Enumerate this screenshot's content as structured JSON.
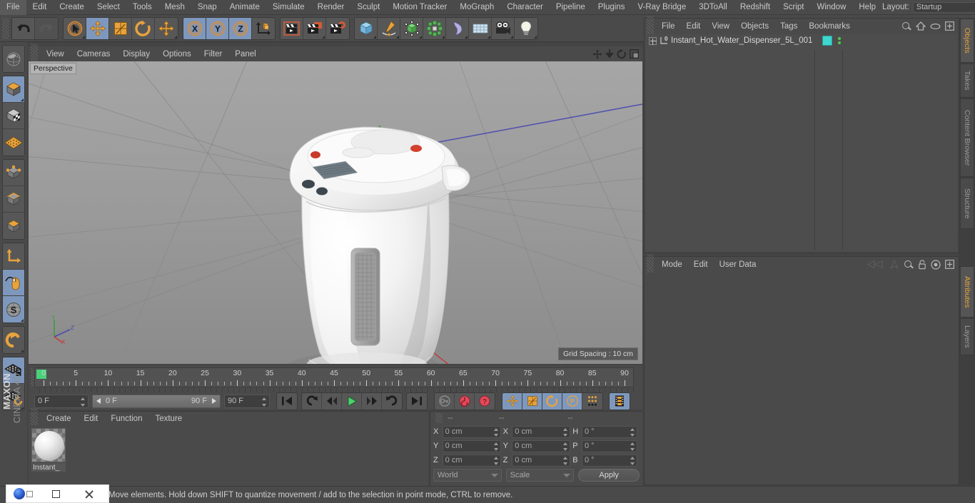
{
  "menubar": {
    "items": [
      "File",
      "Edit",
      "Create",
      "Select",
      "Tools",
      "Mesh",
      "Snap",
      "Animate",
      "Simulate",
      "Render",
      "Sculpt",
      "Motion Tracker",
      "MoGraph",
      "Character",
      "Pipeline",
      "Plugins",
      "V-Ray Bridge",
      "3DToAll",
      "Redshift",
      "Script",
      "Window",
      "Help"
    ],
    "layout_label": "Layout:",
    "layout_value": "Startup",
    "search_icon": "magnifier-icon"
  },
  "toolbar": {
    "groups": [
      {
        "buttons": [
          {
            "name": "undo",
            "icon": "undo-arrow-icon",
            "active": false,
            "disabled": false
          },
          {
            "name": "redo",
            "icon": "redo-arrow-icon",
            "active": false,
            "disabled": true
          }
        ]
      },
      {
        "buttons": [
          {
            "name": "live-selection",
            "icon": "cursor-circle-icon",
            "active": false,
            "disabled": false,
            "corner": true
          },
          {
            "name": "move",
            "icon": "move-arrows-icon",
            "active": true,
            "disabled": false
          },
          {
            "name": "scale",
            "icon": "scale-box-icon",
            "active": false,
            "disabled": false
          },
          {
            "name": "rotate",
            "icon": "rotate-circle-icon",
            "active": false,
            "disabled": false
          },
          {
            "name": "move-extra",
            "icon": "move-arrows-icon",
            "active": false,
            "disabled": false,
            "corner": true
          }
        ]
      },
      {
        "buttons": [
          {
            "name": "lock-x",
            "icon": "axis-x-icon",
            "active": true,
            "label": "X"
          },
          {
            "name": "lock-y",
            "icon": "axis-y-icon",
            "active": true,
            "label": "Y"
          },
          {
            "name": "lock-z",
            "icon": "axis-z-icon",
            "active": true,
            "label": "Z"
          },
          {
            "name": "world-object-coord",
            "icon": "coordinate-cube-icon",
            "active": false
          }
        ]
      },
      {
        "buttons": [
          {
            "name": "render-view",
            "icon": "clapper-icon",
            "active": false
          },
          {
            "name": "render-region",
            "icon": "clapper-region-icon",
            "active": false,
            "corner": true
          },
          {
            "name": "render-settings",
            "icon": "clapper-gear-icon",
            "active": false
          }
        ]
      },
      {
        "buttons": [
          {
            "name": "add-cube",
            "icon": "cube-icon",
            "active": false,
            "corner": true
          },
          {
            "name": "add-spline",
            "icon": "pen-spline-icon",
            "active": false,
            "corner": true
          },
          {
            "name": "add-nurbs",
            "icon": "green-cube-nurbs-icon",
            "active": false,
            "corner": true
          },
          {
            "name": "add-array",
            "icon": "green-cluster-icon",
            "active": false,
            "corner": true
          },
          {
            "name": "add-bend",
            "icon": "bend-deformer-icon",
            "active": false,
            "corner": true
          },
          {
            "name": "add-floor",
            "icon": "floor-grid-icon",
            "active": false,
            "corner": true
          },
          {
            "name": "add-camera",
            "icon": "camera-icon",
            "active": false,
            "corner": true
          },
          {
            "name": "add-light",
            "icon": "light-bulb-icon",
            "active": false,
            "corner": true
          }
        ]
      }
    ]
  },
  "left_palette": {
    "groups": [
      [
        {
          "name": "make-editable",
          "icon": "globe-wire-icon",
          "active": false
        }
      ],
      [
        {
          "name": "model-mode",
          "icon": "orange-cube-icon",
          "active": true,
          "corner": true
        },
        {
          "name": "texture-mode",
          "icon": "checker-cube-icon",
          "active": false
        },
        {
          "name": "workplane-mode",
          "icon": "orange-grid-plane-icon",
          "active": false
        }
      ],
      [
        {
          "name": "points-mode",
          "icon": "points-cube-icon",
          "active": false
        },
        {
          "name": "edges-mode",
          "icon": "edges-cube-icon",
          "active": false
        },
        {
          "name": "polygons-mode",
          "icon": "polygon-cube-icon",
          "active": false
        }
      ],
      [
        {
          "name": "object-axis-mode",
          "icon": "axis-l-icon",
          "active": false
        },
        {
          "name": "enable-snap",
          "icon": "mouse-snap-icon",
          "active": true
        },
        {
          "name": "lock-selection",
          "icon": "s-circle-icon",
          "active": true,
          "corner": true
        }
      ],
      [
        {
          "name": "undo-view",
          "icon": "magnet-icon",
          "active": false,
          "corner": true
        }
      ],
      [
        {
          "name": "lock-workplane",
          "icon": "grid-lock-icon",
          "active": true
        },
        {
          "name": "reset-workplane",
          "icon": "grid-rotate-icon",
          "active": false,
          "corner": true
        }
      ]
    ],
    "brand_top": "MAXON",
    "brand_bottom": "CINEMA 4D"
  },
  "viewport": {
    "menu": [
      "View",
      "Cameras",
      "Display",
      "Options",
      "Filter",
      "Panel"
    ],
    "corner_icons": [
      "pan-icon",
      "dolly-icon",
      "rotate-icon",
      "maximize-icon"
    ],
    "label": "Perspective",
    "grid_spacing": "Grid Spacing : 10 cm",
    "axis_labels": [
      "Y",
      "Z",
      "X"
    ],
    "object_description": "white-instant-hot-water-dispenser-3d-model"
  },
  "timeline": {
    "ticks": [
      {
        "value": "0",
        "pos": 0
      },
      {
        "value": "5",
        "pos": 5
      },
      {
        "value": "10",
        "pos": 10
      },
      {
        "value": "15",
        "pos": 15
      },
      {
        "value": "20",
        "pos": 20
      },
      {
        "value": "25",
        "pos": 25
      },
      {
        "value": "30",
        "pos": 30
      },
      {
        "value": "35",
        "pos": 35
      },
      {
        "value": "40",
        "pos": 40
      },
      {
        "value": "45",
        "pos": 45
      },
      {
        "value": "50",
        "pos": 50
      },
      {
        "value": "55",
        "pos": 55
      },
      {
        "value": "60",
        "pos": 60
      },
      {
        "value": "65",
        "pos": 65
      },
      {
        "value": "70",
        "pos": 70
      },
      {
        "value": "75",
        "pos": 75
      },
      {
        "value": "80",
        "pos": 80
      },
      {
        "value": "85",
        "pos": 85
      },
      {
        "value": "90",
        "pos": 90
      }
    ],
    "current_frame": "0 F",
    "range_start": "0 F",
    "range_end": "90 F",
    "end_frame": "90 F",
    "preview_frame": "0 F",
    "transport": [
      {
        "name": "go-to-start",
        "icon": "skip-start-icon"
      },
      {
        "name": "play-backwards-loop",
        "icon": "loop-back-icon"
      },
      {
        "name": "step-back",
        "icon": "step-back-icon"
      },
      {
        "name": "play-forward",
        "icon": "play-icon",
        "accent": "#4bd46b"
      },
      {
        "name": "step-forward",
        "icon": "step-forward-icon"
      },
      {
        "name": "play-loop",
        "icon": "loop-forward-icon"
      },
      {
        "name": "go-to-end",
        "icon": "skip-end-icon"
      }
    ],
    "record_tools": [
      {
        "name": "record-active-objects",
        "icon": "key-icon",
        "active": false
      },
      {
        "name": "autokeying",
        "icon": "record-circle-icon",
        "accent": "#e24b5a"
      },
      {
        "name": "keyframe-selection",
        "icon": "question-circle-icon",
        "accent": "#e24b5a"
      }
    ],
    "keyframe_tools": [
      {
        "name": "position-key",
        "icon": "move-arrows-icon",
        "active": true
      },
      {
        "name": "scale-key",
        "icon": "scale-box-icon",
        "active": true
      },
      {
        "name": "rotation-key",
        "icon": "rotate-circle-icon",
        "active": true
      },
      {
        "name": "param-key",
        "icon": "p-circle-icon",
        "active": true
      },
      {
        "name": "pla-key",
        "icon": "dots-grid-icon",
        "active": false
      },
      {
        "name": "film-strip",
        "icon": "film-strip-icon",
        "active": true
      }
    ]
  },
  "material_manager": {
    "menu": [
      "Create",
      "Edit",
      "Function",
      "Texture"
    ],
    "materials": [
      {
        "name": "Instant_",
        "icon": "material-sphere-icon"
      }
    ]
  },
  "coordinates": {
    "header_dashes": [
      "--",
      "--",
      "--"
    ],
    "rows": [
      {
        "pos_label": "X",
        "pos_value": "0 cm",
        "size_label": "X",
        "size_value": "0 cm",
        "rot_label": "H",
        "rot_value": "0 °"
      },
      {
        "pos_label": "Y",
        "pos_value": "0 cm",
        "size_label": "Y",
        "size_value": "0 cm",
        "rot_label": "P",
        "rot_value": "0 °"
      },
      {
        "pos_label": "Z",
        "pos_value": "0 cm",
        "size_label": "Z",
        "size_value": "0 cm",
        "rot_label": "B",
        "rot_value": "0 °"
      }
    ],
    "system": "World",
    "mode": "Scale",
    "apply_label": "Apply"
  },
  "object_manager": {
    "menu": [
      "File",
      "Edit",
      "View",
      "Objects",
      "Tags",
      "Bookmarks"
    ],
    "icons": [
      "magnifier-icon",
      "home-icon",
      "eye-icon",
      "plus-box-icon"
    ],
    "objects": [
      {
        "name": "Instant_Hot_Water_Dispenser_5L_001",
        "type": "null-object",
        "tag_color": "#3fd6cf",
        "visibility_dots": 2
      }
    ]
  },
  "attribute_manager": {
    "menu": [
      "Mode",
      "Edit",
      "User Data"
    ],
    "icons": [
      "history-back-icon",
      "history-forward-icon",
      "pin-icon",
      "magnifier-icon",
      "lock-icon",
      "target-icon",
      "plus-box-icon"
    ]
  },
  "vertical_tabs": {
    "top": [
      {
        "label": "Objects",
        "selected": true
      },
      {
        "label": "Takes",
        "selected": false
      },
      {
        "label": "Content Browser",
        "selected": false
      },
      {
        "label": "Structure",
        "selected": false
      }
    ],
    "bottom": [
      {
        "label": "Attributes",
        "selected": true
      },
      {
        "label": "Layers",
        "selected": false
      }
    ]
  },
  "status_bar": {
    "text": "Move elements. Hold down SHIFT to quantize movement / add to the selection in point mode, CTRL to remove."
  },
  "taskbar": {
    "items": [
      {
        "name": "cinema4d-app-icon",
        "icon": "c4d-logo-icon"
      },
      {
        "name": "restore-window",
        "icon": "window-restore-icon"
      },
      {
        "name": "close-window",
        "icon": "close-x-icon"
      }
    ]
  },
  "colors": {
    "panel_bg": "#4a4a4a",
    "button_bg": "#575757",
    "active_blue": "#7e98bd",
    "accent_orange": "#e8a33d",
    "text": "#c8c8c8",
    "viewport_bg": "#999999",
    "green_play": "#4bd46b",
    "red_record": "#e24b5a",
    "teal_tag": "#3fd6cf"
  }
}
